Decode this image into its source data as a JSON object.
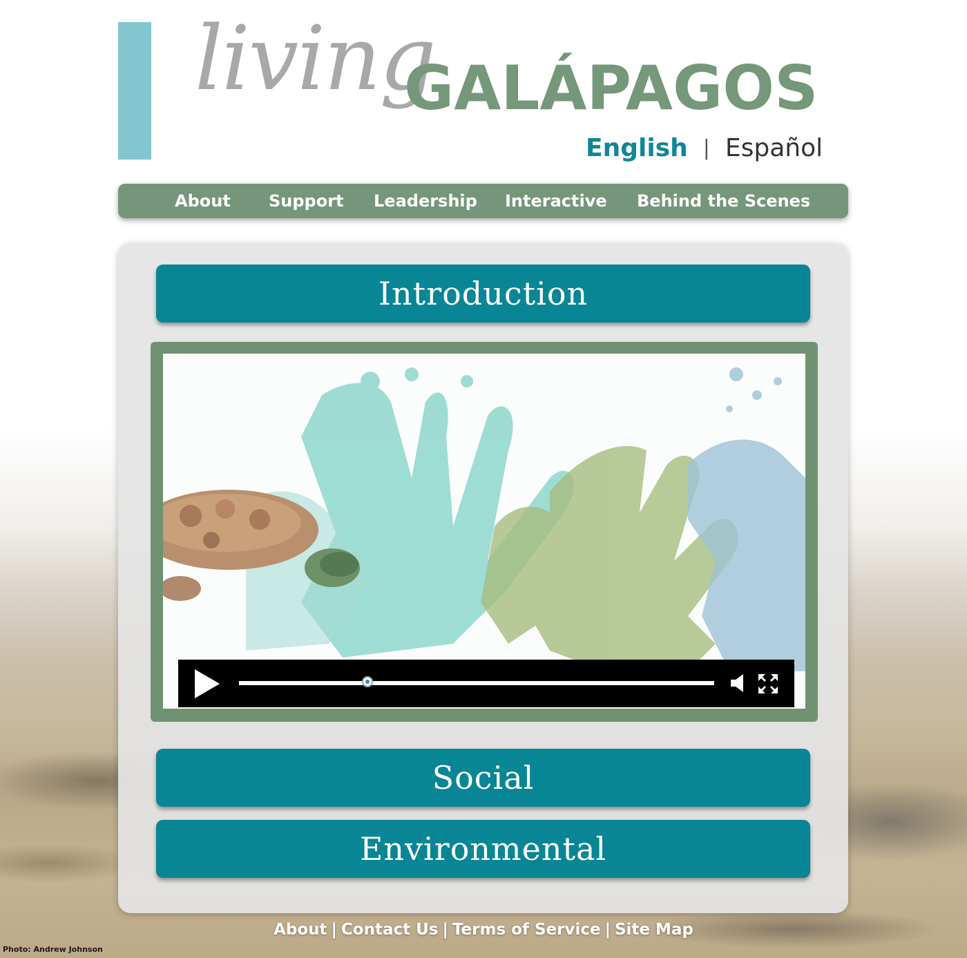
{
  "brand": {
    "logo_script": "living",
    "logo_name": "GALÁPAGOS",
    "accent_bar_color": "#84c6cf",
    "name_color": "#75977a"
  },
  "language": {
    "current": "English",
    "separator": "|",
    "other": "Español"
  },
  "nav": {
    "items": [
      "About",
      "Support",
      "Leadership",
      "Interactive",
      "Behind the Scenes"
    ],
    "color": "#76967b"
  },
  "sections": {
    "intro": "Introduction",
    "social": "Social",
    "environmental": "Environmental",
    "color": "#088695"
  },
  "video": {
    "progress": 0.27,
    "controls": [
      "play-icon",
      "volume-icon",
      "fullscreen-icon"
    ]
  },
  "footer": {
    "links": [
      "About",
      "Contact Us",
      "Terms of Service",
      "Site Map"
    ],
    "separator": "|"
  },
  "photo_credit": "Photo: Andrew Johnson"
}
